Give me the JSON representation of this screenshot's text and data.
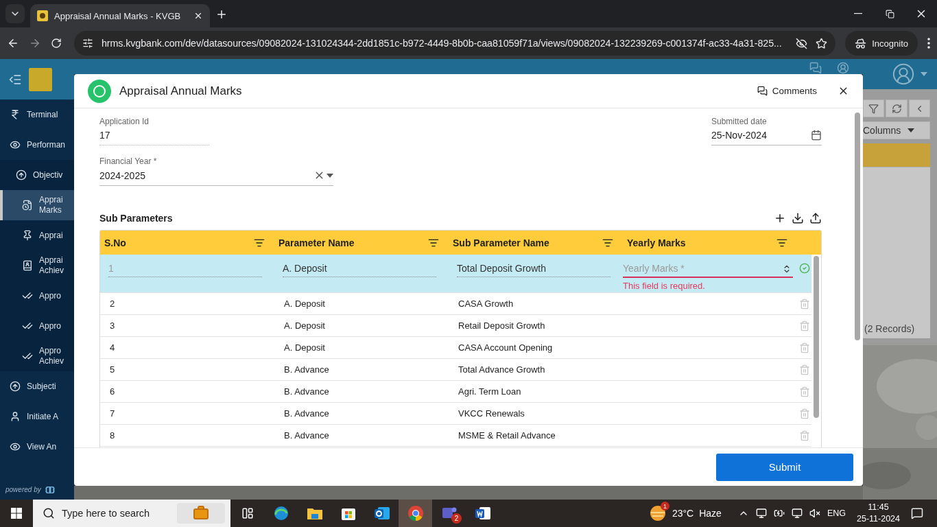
{
  "browser": {
    "tab_title": "Appraisal Annual Marks - KVGB",
    "url": "hrms.kvgbank.com/dev/datasources/09082024-131024344-2dd1851c-b972-4449-8b0b-caa81059f71a/views/09082024-132239269-c001374f-ac33-4a31-825...",
    "profile": "Incognito"
  },
  "sidebar": {
    "items": [
      {
        "kind": "rupee",
        "label": "Terminal",
        "selected": false
      },
      {
        "kind": "eye-hand",
        "label": "Performan",
        "selected": false,
        "children": [
          {
            "kind": "up",
            "label": "Objectiv",
            "selected": false,
            "children": [
              {
                "kind": "doc",
                "label": "Apprai Marks",
                "selected": true
              },
              {
                "kind": "pin",
                "label": "Apprai",
                "selected": false
              },
              {
                "kind": "book",
                "label": "Apprai Achiev",
                "selected": false
              },
              {
                "kind": "check",
                "label": "Appro",
                "selected": false
              },
              {
                "kind": "check",
                "label": "Appro",
                "selected": false
              },
              {
                "kind": "check",
                "label": "Appro Achiev",
                "selected": false
              }
            ]
          }
        ]
      },
      {
        "kind": "up",
        "label": "Subjecti",
        "selected": false
      },
      {
        "kind": "person",
        "label": "Initiate A",
        "selected": false
      },
      {
        "kind": "eye",
        "label": "View An",
        "selected": false
      }
    ],
    "footer": "powered by"
  },
  "background": {
    "columns_button": "Columns",
    "records": "(2 Records)"
  },
  "dialog": {
    "title": "Appraisal Annual Marks",
    "comments": "Comments",
    "application_id": {
      "label": "Application Id",
      "value": "17"
    },
    "submitted_date": {
      "label": "Submitted date",
      "value": "25-Nov-2024"
    },
    "financial_year": {
      "label": "Financial Year *",
      "value": "2024-2025"
    },
    "section_title": "Sub Parameters",
    "table": {
      "columns": [
        "S.No",
        "Parameter Name",
        "Sub Parameter Name",
        "Yearly Marks"
      ],
      "rows": [
        {
          "sno": "1",
          "parameter": "A. Deposit",
          "sub_parameter": "Total Deposit Growth",
          "selected": true,
          "yearly_marks": {
            "placeholder": "Yearly Marks *",
            "error": "This field is required."
          }
        },
        {
          "sno": "2",
          "parameter": "A. Deposit",
          "sub_parameter": "CASA Growth",
          "selected": false
        },
        {
          "sno": "3",
          "parameter": "A. Deposit",
          "sub_parameter": "Retail Deposit Growth",
          "selected": false
        },
        {
          "sno": "4",
          "parameter": "A. Deposit",
          "sub_parameter": "CASA Account Opening",
          "selected": false
        },
        {
          "sno": "5",
          "parameter": "B. Advance",
          "sub_parameter": "Total Advance Growth",
          "selected": false
        },
        {
          "sno": "6",
          "parameter": "B. Advance",
          "sub_parameter": "Agri. Term Loan",
          "selected": false
        },
        {
          "sno": "7",
          "parameter": "B. Advance",
          "sub_parameter": "VKCC Renewals",
          "selected": false
        },
        {
          "sno": "8",
          "parameter": "B. Advance",
          "sub_parameter": "MSME & Retail Advance",
          "selected": false
        }
      ]
    },
    "submit": "Submit"
  },
  "taskbar": {
    "search_placeholder": "Type here to search",
    "teams_badge": "2",
    "weather_badge": "1",
    "temperature": "23°C",
    "weather": "Haze",
    "language": "ENG",
    "time": "11:45",
    "date": "25-11-2024"
  }
}
